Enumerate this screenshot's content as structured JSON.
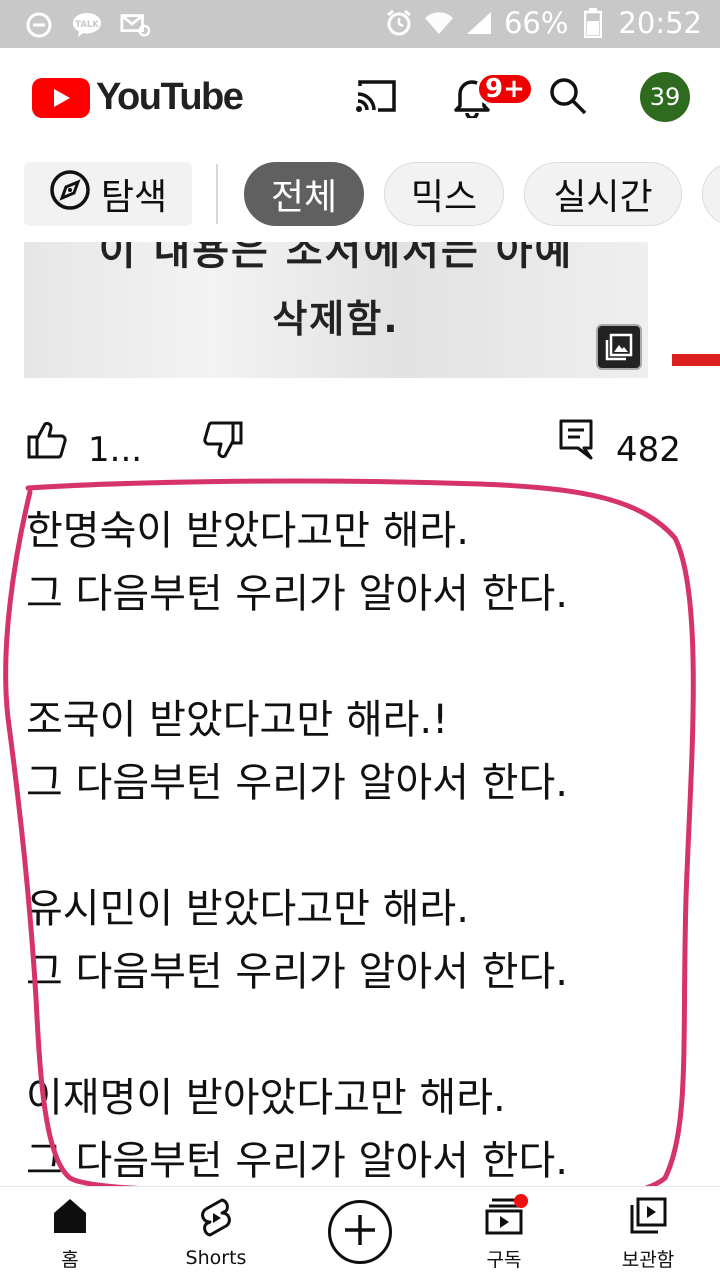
{
  "status_bar": {
    "battery": "66%",
    "time": "20:52",
    "icons": [
      "minus-circle-icon",
      "talk-icon",
      "mail-icon",
      "alarm-icon",
      "wifi-icon",
      "signal-icon",
      "battery-icon"
    ],
    "talk_icon_text": "TALK"
  },
  "header": {
    "logo_text": "YouTube",
    "notification_badge": "9+",
    "avatar_text": "39",
    "brand_color": "#ff0000"
  },
  "chips": {
    "explore": "탐색",
    "items": [
      "전체",
      "믹스",
      "실시간"
    ]
  },
  "thumbnail": {
    "cut_text": "이 내용은 조서에서는 아예",
    "caption": "삭제함."
  },
  "actions": {
    "like_count": "1...",
    "comment_count": "482"
  },
  "comment_lines": "한명숙이 받았다고만 해라.\n그 다음부턴 우리가 알아서 한다.\n\n조국이 받았다고만 해라.!\n그 다음부턴 우리가 알아서 한다.\n\n유시민이 받았다고만 해라.\n그 다음부턴 우리가 알아서 한다.\n\n이재명이 받아았다고만 해라.\n그 다음부턴 우리가 알아서 한다.",
  "bottom_nav": {
    "home": "홈",
    "shorts": "Shorts",
    "subscriptions": "구독",
    "library": "보관함"
  },
  "annotation_color": "#d6336c"
}
